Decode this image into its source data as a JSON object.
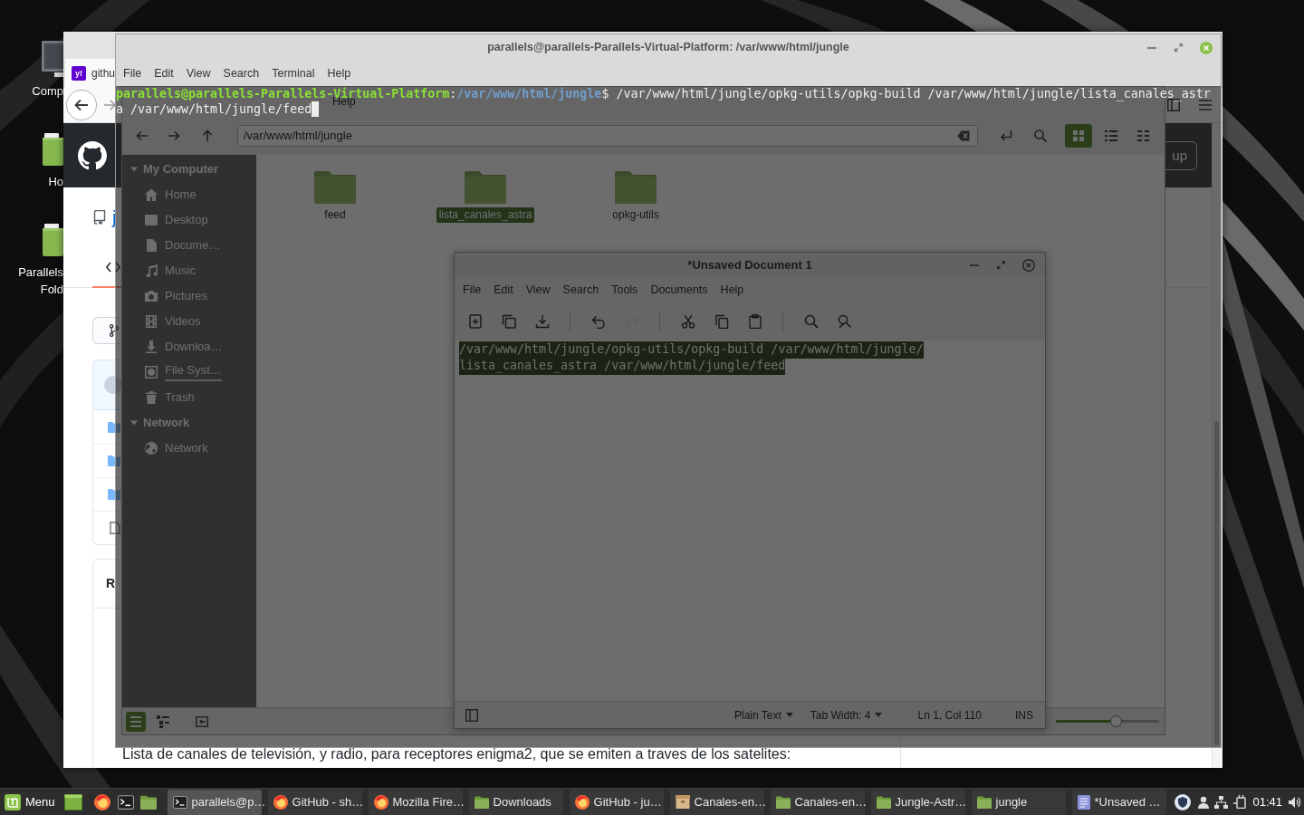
{
  "desktop_icons": [
    {
      "kind": "computer",
      "label_lines": [
        "Comp"
      ]
    },
    {
      "kind": "home",
      "label_lines": [
        "Ho"
      ]
    },
    {
      "kind": "folder",
      "label_lines": [
        "Parallels",
        "Fold"
      ]
    }
  ],
  "browser": {
    "tab": {
      "favicon": "y!",
      "title": "githu"
    },
    "header_button": "up",
    "repo_name": "j",
    "readme_heading": "R",
    "readme_text": "Lista de canales de televisión, y radio, para receptores enigma2, que se emiten a traves de los satelites:"
  },
  "file_manager": {
    "menu": [
      "Help"
    ],
    "path": "/var/www/html/jungle",
    "view_modes": [
      {
        "kind": "grid",
        "selected": true
      },
      {
        "kind": "list",
        "selected": false
      },
      {
        "kind": "compact",
        "selected": false
      }
    ],
    "sidebar": [
      {
        "title": "My Computer",
        "expanded": true,
        "items": [
          {
            "kind": "home",
            "label": "Home"
          },
          {
            "kind": "desktop",
            "label": "Desktop"
          },
          {
            "kind": "documents",
            "label": "Docume…"
          },
          {
            "kind": "music",
            "label": "Music"
          },
          {
            "kind": "pictures",
            "label": "Pictures"
          },
          {
            "kind": "videos",
            "label": "Videos"
          },
          {
            "kind": "downloads",
            "label": "Downloa…"
          },
          {
            "kind": "drive",
            "label": "File Syst…"
          },
          {
            "kind": "trash",
            "label": "Trash"
          }
        ]
      },
      {
        "title": "Network",
        "expanded": true,
        "items": [
          {
            "kind": "network",
            "label": "Network"
          }
        ]
      }
    ],
    "files": [
      {
        "name": "feed",
        "selected": false
      },
      {
        "name": "lista_canales_astra",
        "selected": true
      },
      {
        "name": "opkg-utils",
        "selected": false
      }
    ],
    "sidebar_modes": [
      {
        "kind": "places",
        "selected": true
      },
      {
        "kind": "tree",
        "selected": false
      }
    ],
    "zoom": {
      "level": 0.58
    }
  },
  "editor": {
    "title": "*Unsaved Document 1",
    "menu": [
      "File",
      "Edit",
      "View",
      "Search",
      "Tools",
      "Documents",
      "Help"
    ],
    "toolbar": [
      [
        {
          "kind": "new",
          "disabled": false
        },
        {
          "kind": "open",
          "disabled": false
        },
        {
          "kind": "save",
          "disabled": false
        }
      ],
      [
        {
          "kind": "undo",
          "disabled": false
        },
        {
          "kind": "redo",
          "disabled": true
        }
      ],
      [
        {
          "kind": "cut",
          "disabled": false
        },
        {
          "kind": "copy",
          "disabled": false
        },
        {
          "kind": "paste",
          "disabled": false
        }
      ],
      [
        {
          "kind": "find",
          "disabled": false
        },
        {
          "kind": "replace",
          "disabled": false
        }
      ]
    ],
    "text": "/var/www/html/jungle/opkg-utils/opkg-build /var/www/html/jungle/lista_canales_astra /var/www/html/jungle/feed",
    "text_selected": true,
    "status": [
      {
        "kind": "dropdown",
        "label": "Plain Text"
      },
      {
        "kind": "dropdown",
        "label": "Tab Width: 4"
      },
      {
        "kind": "label",
        "label": "Ln 1, Col 110"
      },
      {
        "kind": "label",
        "label": "INS"
      }
    ]
  },
  "terminal": {
    "title": "parallels@parallels-Parallels-Virtual-Platform: /var/www/html/jungle",
    "menu": [
      "File",
      "Edit",
      "View",
      "Search",
      "Terminal",
      "Help"
    ],
    "prompt": {
      "user_host": "parallels@parallels-Parallels-Virtual-Platform",
      "separator": ":",
      "cwd": "/var/www/html/jungle",
      "symbol": "$"
    },
    "command": "/var/www/html/jungle/opkg-utils/opkg-build /var/www/html/jungle/lista_canales_astra /var/www/html/jungle/feed"
  },
  "taskbar": {
    "menu_label": "Menu",
    "launchers": [
      {
        "kind": "desktop"
      },
      {
        "kind": "firefox"
      },
      {
        "kind": "terminal"
      },
      {
        "kind": "folder"
      }
    ],
    "windows": [
      {
        "kind": "terminal",
        "title": "parallels@p…",
        "selected": true
      },
      {
        "kind": "firefox",
        "title": "GitHub - sh…",
        "selected": false
      },
      {
        "kind": "firefox",
        "title": "Mozilla Fire…",
        "selected": false
      },
      {
        "kind": "folder",
        "title": "Downloads",
        "selected": false
      },
      {
        "kind": "firefox",
        "title": "GitHub - ju…",
        "selected": false
      },
      {
        "kind": "archive",
        "title": "Canales-en…",
        "selected": false
      },
      {
        "kind": "folder",
        "title": "Canales-en…",
        "selected": false
      },
      {
        "kind": "folder",
        "title": "Jungle-Astr…",
        "selected": false
      },
      {
        "kind": "folder",
        "title": "jungle",
        "selected": false
      },
      {
        "kind": "editor",
        "title": "*Unsaved …",
        "selected": false
      }
    ],
    "tray": [
      {
        "kind": "shield"
      },
      {
        "kind": "user"
      },
      {
        "kind": "network"
      },
      {
        "kind": "power"
      },
      {
        "kind": "clock",
        "label": "01:41"
      },
      {
        "kind": "volume"
      }
    ]
  }
}
